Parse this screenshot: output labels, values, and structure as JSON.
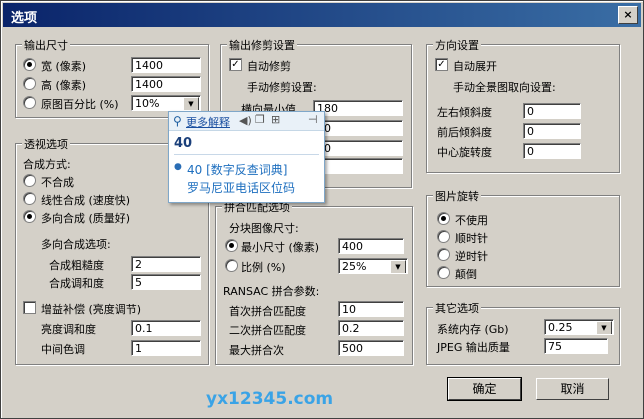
{
  "window": {
    "title": "选项",
    "close": "×"
  },
  "output_size": {
    "label": "输出尺寸",
    "width_label": "宽 (像素)",
    "width_value": "1400",
    "height_label": "高 (像素)",
    "height_value": "1400",
    "percent_label": "原图百分比 (%)",
    "percent_value": "10%"
  },
  "crop": {
    "label": "输出修剪设置",
    "auto": "自动修剪",
    "manual": "手动修剪设置:",
    "row1_label": "横向最小值",
    "row1_value": "180",
    "row2_value": "80",
    "row3_value": "00",
    "row4_value": "0"
  },
  "direction": {
    "label": "方向设置",
    "auto": "自动展开",
    "manual": "手动全景图取向设置:",
    "lr_label": "左右倾斜度",
    "lr_value": "0",
    "fb_label": "前后倾斜度",
    "fb_value": "0",
    "center_label": "中心旋转度",
    "center_value": "0"
  },
  "perspective": {
    "label": "透视选项",
    "method": "合成方式:",
    "opt1": "不合成",
    "opt2": "线性合成 (速度快)",
    "opt3": "多向合成 (质量好)",
    "multi": "多向合成选项:",
    "rough_label": "合成粗糙度",
    "rough_value": "2",
    "blend_label": "合成调和度",
    "blend_value": "5",
    "gain": "增益补偿 (亮度调节)",
    "bright_label": "亮度调和度",
    "bright_value": "0.1",
    "mid_label": "中间色调",
    "mid_value": "1"
  },
  "match": {
    "label": "拼合匹配选项",
    "size": "分块图像尺寸:",
    "min_label": "最小尺寸 (像素)",
    "min_value": "400",
    "ratio_label": "比例 (%)",
    "ratio_value": "25%",
    "ransac": "RANSAC 拼合参数:",
    "first_label": "首次拼合匹配度",
    "first_value": "10",
    "second_label": "二次拼合匹配度",
    "second_value": "0.2",
    "max_label": "最大拼合次",
    "max_value": "500"
  },
  "rotate": {
    "label": "图片旋转",
    "opt1": "不使用",
    "opt2": "顺时针",
    "opt3": "逆时针",
    "opt4": "颠倒"
  },
  "other": {
    "label": "其它选项",
    "mem_label": "系统内存 (Gb)",
    "mem_value": "0.25",
    "jpeg_label": "JPEG 输出质量",
    "jpeg_value": "75"
  },
  "buttons": {
    "ok": "确定",
    "cancel": "取消"
  },
  "popup": {
    "more": "更多解释",
    "word": "40",
    "entry": "40 [数字反查词典]",
    "entry2": "罗马尼亚电话区位码"
  },
  "watermark": "yx12345.com"
}
